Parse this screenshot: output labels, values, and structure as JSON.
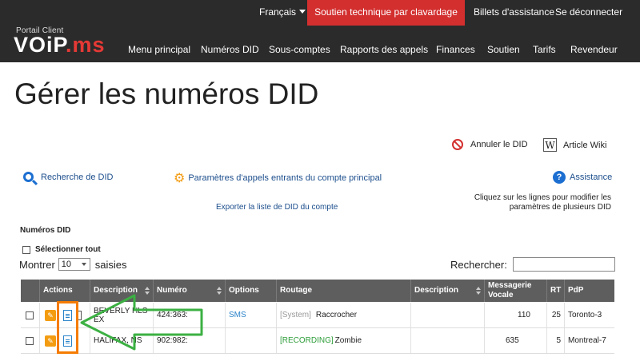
{
  "header": {
    "logo_small": "Portail Client",
    "logo_main_a": "VOiP",
    "logo_main_b": ".ms",
    "language": "Français",
    "support_button": "Soutien technique par clavardage",
    "tickets": "Billets d'assistance",
    "logout": "Se déconnecter",
    "nav": [
      "Menu principal",
      "Numéros DID",
      "Sous-comptes",
      "Rapports des appels",
      "Finances",
      "Soutien",
      "Tarifs",
      "Revendeur"
    ]
  },
  "page": {
    "title": "Gérer les numéros DID",
    "cancel_did": "Annuler le DID",
    "wiki_article": "Article Wiki",
    "wiki_icon_letter": "W",
    "search_did": "Recherche de DID",
    "incoming_params": "Paramètres d'appels entrants du compte principal",
    "assistance": "Assistance",
    "help_icon_letter": "?",
    "note_line1": "Cliquez sur les lignes pour modifier les",
    "note_line2": "paramètres de plusieurs DID",
    "export": "Exporter la liste de DID du compte",
    "section_title": "Numéros DID",
    "select_all": "Sélectionner tout",
    "show_label": "Montrer",
    "show_value": "10",
    "entries_label": "saisies",
    "search_label": "Rechercher:",
    "search_value": ""
  },
  "table": {
    "headers": [
      "Actions",
      "Description",
      "Numéro",
      "Options",
      "Routage",
      "Description",
      "Messagerie Vocale",
      "RT",
      "PdP"
    ],
    "rows": [
      {
        "description": "BEVERLY HLS EX",
        "number": "424:363:",
        "options": "SMS",
        "routing_tag": "[System]",
        "routing": "Raccrocher",
        "description2": "",
        "voicemail": "110",
        "rt": "25",
        "pop": "Toronto-3"
      },
      {
        "description": "HALIFAX, NS",
        "number": "902:982:",
        "options": "",
        "routing_tag": "[RECORDING]",
        "routing": "Zombie",
        "description2": "",
        "voicemail": "635",
        "rt": "5",
        "pop": "Montreal-7"
      }
    ]
  },
  "colors": {
    "header_bg": "#2b2b2b",
    "support_red": "#d32f2f",
    "table_header": "#5e5e5e",
    "highlight_orange": "#f57c00",
    "arrow_green": "#3cb043",
    "link_blue": "#1c4e8c"
  },
  "icons": {
    "cancel": "no-entry-icon",
    "wiki": "wiki-icon",
    "search": "magnifier-icon",
    "gear": "gears-icon",
    "help": "help-icon",
    "edit": "pencil-icon",
    "details": "document-icon"
  }
}
